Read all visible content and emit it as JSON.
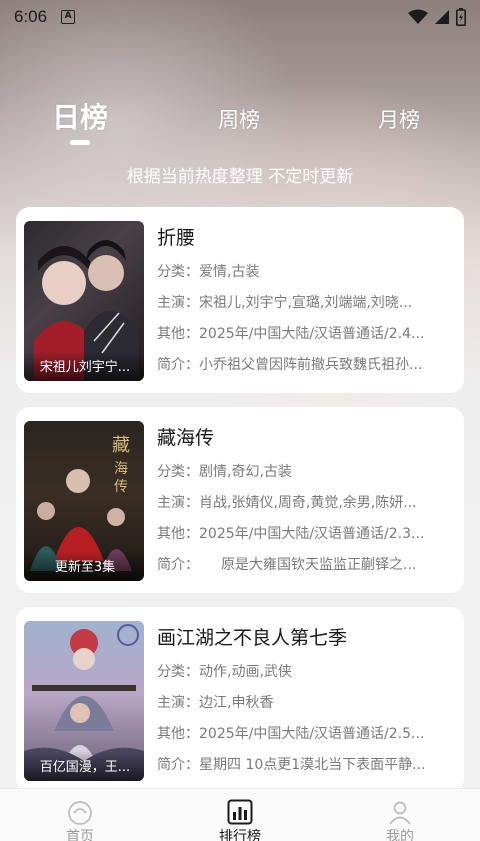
{
  "status_bar": {
    "time": "6:06",
    "notification_icon": "A"
  },
  "tabs": [
    {
      "label": "日榜",
      "active": true
    },
    {
      "label": "周榜",
      "active": false
    },
    {
      "label": "月榜",
      "active": false
    }
  ],
  "subtitle": "根据当前热度整理 不定时更新",
  "items": [
    {
      "title": "折腰",
      "poster_caption": "宋祖儿刘宇宁...",
      "category_label": "分类：",
      "category": "爱情,古装",
      "cast_label": "主演：",
      "cast": "宋祖儿,刘宇宁,宣璐,刘端端,刘晓...",
      "other_label": "其他：",
      "other": "2025年/中国大陆/汉语普通话/2.4...",
      "intro_label": "简介：",
      "intro": "小乔祖父曾因阵前撤兵致魏氏祖孙..."
    },
    {
      "title": "藏海传",
      "poster_caption": "更新至3集",
      "category_label": "分类：",
      "category": "剧情,奇幻,古装",
      "cast_label": "主演：",
      "cast": "肖战,张婧仪,周奇,黄觉,余男,陈妍...",
      "other_label": "其他：",
      "other": "2025年/中国大陆/汉语普通话/2.3...",
      "intro_label": "简介：",
      "intro": "原是大雍国钦天监监正蒯铎之..."
    },
    {
      "title": "画江湖之不良人第七季",
      "poster_caption": "百亿国漫，王...",
      "category_label": "分类：",
      "category": "动作,动画,武侠",
      "cast_label": "主演：",
      "cast": "边江,申秋香",
      "other_label": "其他：",
      "other": "2025年/中国大陆/汉语普通话/2.5...",
      "intro_label": "简介：",
      "intro": "星期四 10点更1漠北当下表面平静..."
    }
  ],
  "bottom_nav": [
    {
      "label": "首页",
      "icon": "home-icon",
      "active": false
    },
    {
      "label": "排行榜",
      "icon": "ranking-icon",
      "active": true
    },
    {
      "label": "我的",
      "icon": "profile-icon",
      "active": false
    }
  ],
  "colors": {
    "accent": "#1a1a1a",
    "inactive_nav": "#9a9a9a",
    "card_bg": "#ffffff"
  }
}
